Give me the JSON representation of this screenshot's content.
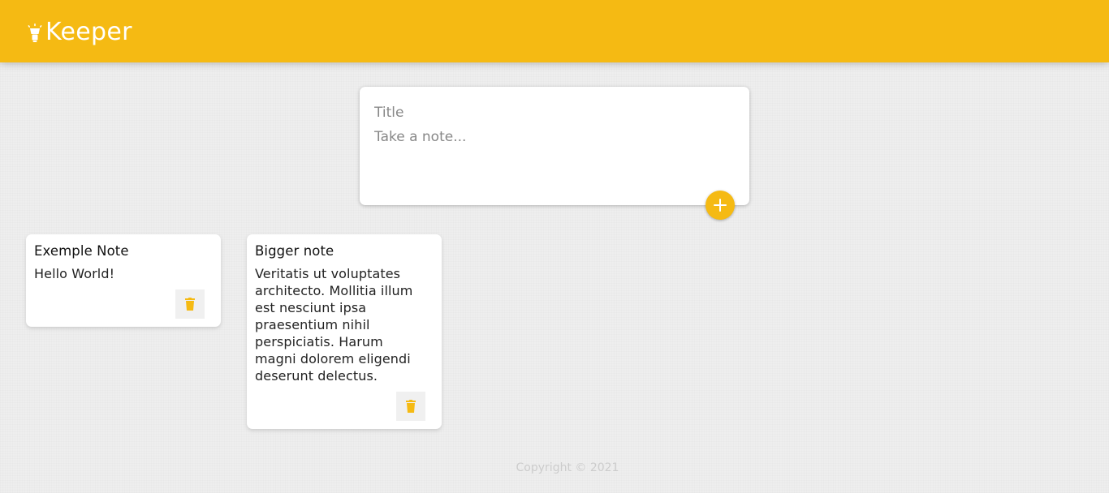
{
  "header": {
    "title": "Keeper",
    "logo_icon": "lightbulb-icon",
    "color": "#f5ba13"
  },
  "create_note": {
    "title_placeholder": "Title",
    "content_placeholder": "Take a note...",
    "add_button_icon": "plus-icon"
  },
  "notes": [
    {
      "title": "Exemple Note",
      "content": "Hello World!",
      "delete_icon": "trash-icon"
    },
    {
      "title": "Bigger note",
      "content": "Veritatis ut voluptates\narchitecto. Mollitia illum\nest nesciunt ipsa\npraesentium nihil\nperspiciatis. Harum\nmagni dolorem eligendi\ndeserunt delectus.",
      "delete_icon": "trash-icon"
    }
  ],
  "footer": {
    "copyright": "Copyright © 2021"
  },
  "colors": {
    "accent": "#f5ba13",
    "background": "#eeeeee",
    "card": "#ffffff"
  }
}
